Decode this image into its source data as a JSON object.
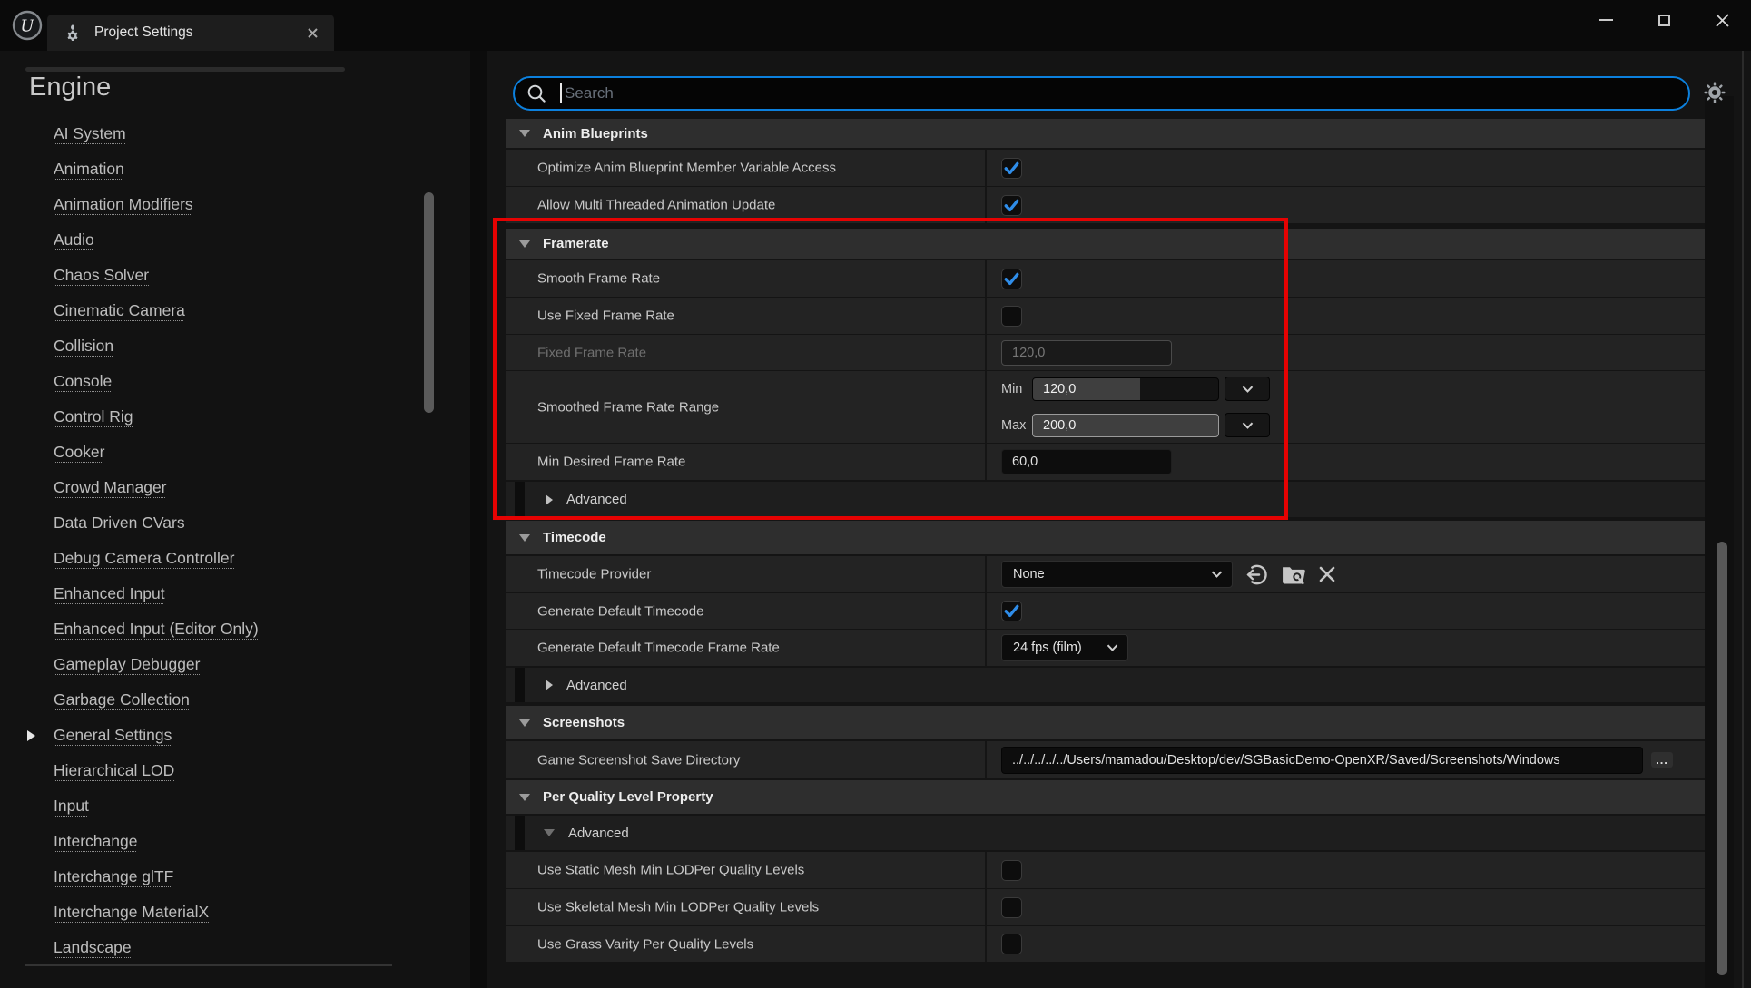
{
  "window": {
    "tab_title": "Project Settings"
  },
  "sidebar": {
    "heading": "Engine",
    "selected_item": "General Settings",
    "items": [
      "AI System",
      "Animation",
      "Animation Modifiers",
      "Audio",
      "Chaos Solver",
      "Cinematic Camera",
      "Collision",
      "Console",
      "Control Rig",
      "Cooker",
      "Crowd Manager",
      "Data Driven CVars",
      "Debug Camera Controller",
      "Enhanced Input",
      "Enhanced Input (Editor Only)",
      "Gameplay Debugger",
      "Garbage Collection",
      "General Settings",
      "Hierarchical LOD",
      "Input",
      "Interchange",
      "Interchange glTF",
      "Interchange MaterialX",
      "Landscape"
    ]
  },
  "search": {
    "placeholder": "Search"
  },
  "panel": {
    "sections": {
      "anim": {
        "title": "Anim Blueprints",
        "optimize": {
          "label": "Optimize Anim Blueprint Member Variable Access",
          "checked": true
        },
        "multithread": {
          "label": "Allow Multi Threaded Animation Update",
          "checked": true
        }
      },
      "framerate": {
        "title": "Framerate",
        "smooth": {
          "label": "Smooth Frame Rate",
          "checked": true
        },
        "use_fixed": {
          "label": "Use Fixed Frame Rate",
          "checked": false
        },
        "fixed": {
          "label": "Fixed Frame Rate",
          "value": "120,0",
          "disabled": true
        },
        "smoothed_range": {
          "label": "Smoothed Frame Rate Range",
          "min_label": "Min",
          "min_value": "120,0",
          "max_label": "Max",
          "max_value": "200,0"
        },
        "min_desired": {
          "label": "Min Desired Frame Rate",
          "value": "60,0"
        },
        "advanced_label": "Advanced"
      },
      "timecode": {
        "title": "Timecode",
        "provider": {
          "label": "Timecode Provider",
          "value": "None"
        },
        "generate_default": {
          "label": "Generate Default Timecode",
          "checked": true
        },
        "default_rate": {
          "label": "Generate Default Timecode Frame Rate",
          "value": "24 fps (film)"
        },
        "advanced_label": "Advanced"
      },
      "screenshots": {
        "title": "Screenshots",
        "save_dir": {
          "label": "Game Screenshot Save Directory",
          "value": "../../../../../Users/mamadou/Desktop/dev/SGBasicDemo-OpenXR/Saved/Screenshots/Windows",
          "more_label": "..."
        }
      },
      "quality": {
        "title": "Per Quality Level Property",
        "advanced_label": "Advanced",
        "static_mesh": {
          "label": "Use Static Mesh Min LODPer Quality Levels",
          "checked": false
        },
        "skeletal_mesh": {
          "label": "Use Skeletal Mesh Min LODPer Quality Levels",
          "checked": false
        },
        "grass": {
          "label": "Use Grass Varity Per Quality Levels",
          "checked": false
        }
      }
    }
  },
  "icons": {
    "unreal-logo": "circle-U",
    "project-settings-icon": "gear-with-sprout",
    "search-icon": "magnifier",
    "settings-gear-icon": "gear",
    "checkbox-check": "blue-checkmark",
    "dropdown-chevron": "chevron-down",
    "use-selected-asset-icon": "circle-left-arrow",
    "browse-asset-icon": "folder-magnifier",
    "clear-icon": "x",
    "collapse-arrow": "triangle-down",
    "expand-arrow": "triangle-right"
  },
  "colors": {
    "accent_blue": "#0C80DD",
    "check_blue": "#2F8DE9",
    "highlight_red": "#E60202",
    "section_header_bg": "#2E2E2E",
    "row_bg": "#232323"
  }
}
